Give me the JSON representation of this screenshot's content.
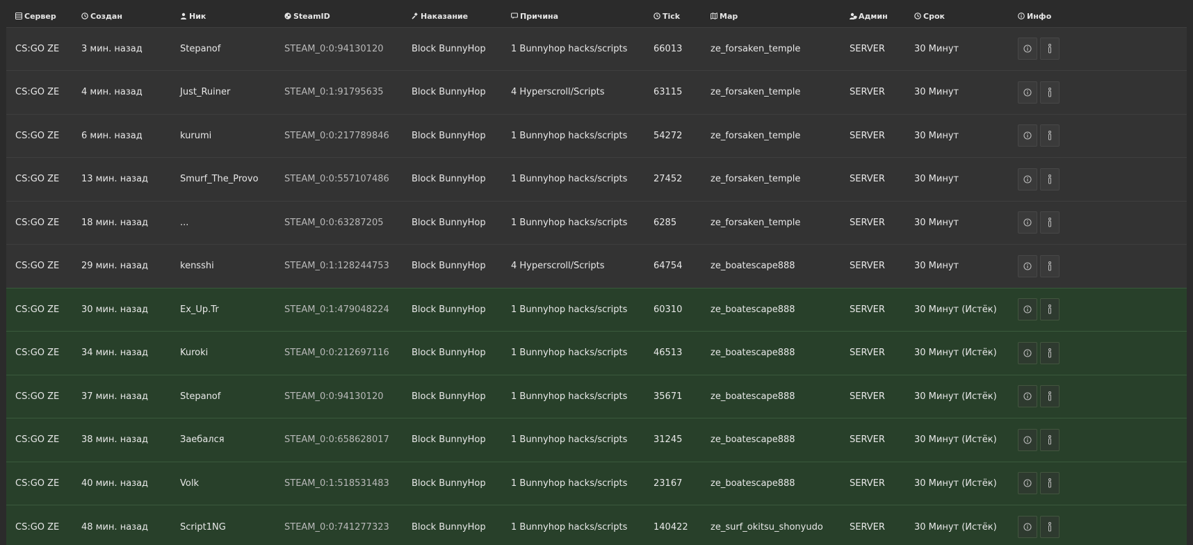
{
  "columns": [
    {
      "key": "server",
      "label": "Сервер",
      "icon": "server-icon"
    },
    {
      "key": "created",
      "label": "Создан",
      "icon": "clock-icon"
    },
    {
      "key": "nick",
      "label": "Ник",
      "icon": "user-icon"
    },
    {
      "key": "steamid",
      "label": "SteamID",
      "icon": "steam-icon"
    },
    {
      "key": "punishment",
      "label": "Наказание",
      "icon": "gavel-icon"
    },
    {
      "key": "reason",
      "label": "Причина",
      "icon": "comment-icon"
    },
    {
      "key": "tick",
      "label": "Tick",
      "icon": "clock-icon"
    },
    {
      "key": "map",
      "label": "Map",
      "icon": "map-icon"
    },
    {
      "key": "admin",
      "label": "Админ",
      "icon": "user-shield-icon"
    },
    {
      "key": "term",
      "label": "Срок",
      "icon": "clock-icon"
    },
    {
      "key": "info",
      "label": "Инфо",
      "icon": "info-icon"
    }
  ],
  "colors": {
    "active_row": "#333333",
    "expired_row": "#28402a"
  },
  "rows": [
    {
      "server": "CS:GO ZE",
      "created": "3 мин. назад",
      "nick": "Stepanof",
      "steamid": "STEAM_0:0:94130120",
      "punishment": "Block BunnyHop",
      "reason": "1 Bunnyhop hacks/scripts",
      "tick": "66013",
      "map": "ze_forsaken_temple",
      "admin": "SERVER",
      "term": "30 Минут",
      "status": "active"
    },
    {
      "server": "CS:GO ZE",
      "created": "4 мин. назад",
      "nick": "Just_Ruiner",
      "steamid": "STEAM_0:1:91795635",
      "punishment": "Block BunnyHop",
      "reason": "4 Hyperscroll/Scripts",
      "tick": "63115",
      "map": "ze_forsaken_temple",
      "admin": "SERVER",
      "term": "30 Минут",
      "status": "active"
    },
    {
      "server": "CS:GO ZE",
      "created": "6 мин. назад",
      "nick": "kurumi",
      "steamid": "STEAM_0:0:217789846",
      "punishment": "Block BunnyHop",
      "reason": "1 Bunnyhop hacks/scripts",
      "tick": "54272",
      "map": "ze_forsaken_temple",
      "admin": "SERVER",
      "term": "30 Минут",
      "status": "active"
    },
    {
      "server": "CS:GO ZE",
      "created": "13 мин. назад",
      "nick": "Smurf_The_Provo",
      "steamid": "STEAM_0:0:557107486",
      "punishment": "Block BunnyHop",
      "reason": "1 Bunnyhop hacks/scripts",
      "tick": "27452",
      "map": "ze_forsaken_temple",
      "admin": "SERVER",
      "term": "30 Минут",
      "status": "active"
    },
    {
      "server": "CS:GO ZE",
      "created": "18 мин. назад",
      "nick": "...",
      "steamid": "STEAM_0:0:63287205",
      "punishment": "Block BunnyHop",
      "reason": "1 Bunnyhop hacks/scripts",
      "tick": "6285",
      "map": "ze_forsaken_temple",
      "admin": "SERVER",
      "term": "30 Минут",
      "status": "active"
    },
    {
      "server": "CS:GO ZE",
      "created": "29 мин. назад",
      "nick": "kensshi",
      "steamid": "STEAM_0:1:128244753",
      "punishment": "Block BunnyHop",
      "reason": "4 Hyperscroll/Scripts",
      "tick": "64754",
      "map": "ze_boatescape888",
      "admin": "SERVER",
      "term": "30 Минут",
      "status": "active"
    },
    {
      "server": "CS:GO ZE",
      "created": "30 мин. назад",
      "nick": "Ex_Up.Tr",
      "steamid": "STEAM_0:1:479048224",
      "punishment": "Block BunnyHop",
      "reason": "1 Bunnyhop hacks/scripts",
      "tick": "60310",
      "map": "ze_boatescape888",
      "admin": "SERVER",
      "term": "30 Минут (Истёк)",
      "status": "expired"
    },
    {
      "server": "CS:GO ZE",
      "created": "34 мин. назад",
      "nick": "Kuroki",
      "steamid": "STEAM_0:0:212697116",
      "punishment": "Block BunnyHop",
      "reason": "1 Bunnyhop hacks/scripts",
      "tick": "46513",
      "map": "ze_boatescape888",
      "admin": "SERVER",
      "term": "30 Минут (Истёк)",
      "status": "expired"
    },
    {
      "server": "CS:GO ZE",
      "created": "37 мин. назад",
      "nick": "Stepanof",
      "steamid": "STEAM_0:0:94130120",
      "punishment": "Block BunnyHop",
      "reason": "1 Bunnyhop hacks/scripts",
      "tick": "35671",
      "map": "ze_boatescape888",
      "admin": "SERVER",
      "term": "30 Минут (Истёк)",
      "status": "expired"
    },
    {
      "server": "CS:GO ZE",
      "created": "38 мин. назад",
      "nick": "Заебался",
      "steamid": "STEAM_0:0:658628017",
      "punishment": "Block BunnyHop",
      "reason": "1 Bunnyhop hacks/scripts",
      "tick": "31245",
      "map": "ze_boatescape888",
      "admin": "SERVER",
      "term": "30 Минут (Истёк)",
      "status": "expired"
    },
    {
      "server": "CS:GO ZE",
      "created": "40 мин. назад",
      "nick": "Volk",
      "steamid": "STEAM_0:1:518531483",
      "punishment": "Block BunnyHop",
      "reason": "1 Bunnyhop hacks/scripts",
      "tick": "23167",
      "map": "ze_boatescape888",
      "admin": "SERVER",
      "term": "30 Минут (Истёк)",
      "status": "expired"
    },
    {
      "server": "CS:GO ZE",
      "created": "48 мин. назад",
      "nick": "Script1NG",
      "steamid": "STEAM_0:0:741277323",
      "punishment": "Block BunnyHop",
      "reason": "1 Bunnyhop hacks/scripts",
      "tick": "140422",
      "map": "ze_surf_okitsu_shonyudo",
      "admin": "SERVER",
      "term": "30 Минут (Истёк)",
      "status": "expired"
    }
  ]
}
